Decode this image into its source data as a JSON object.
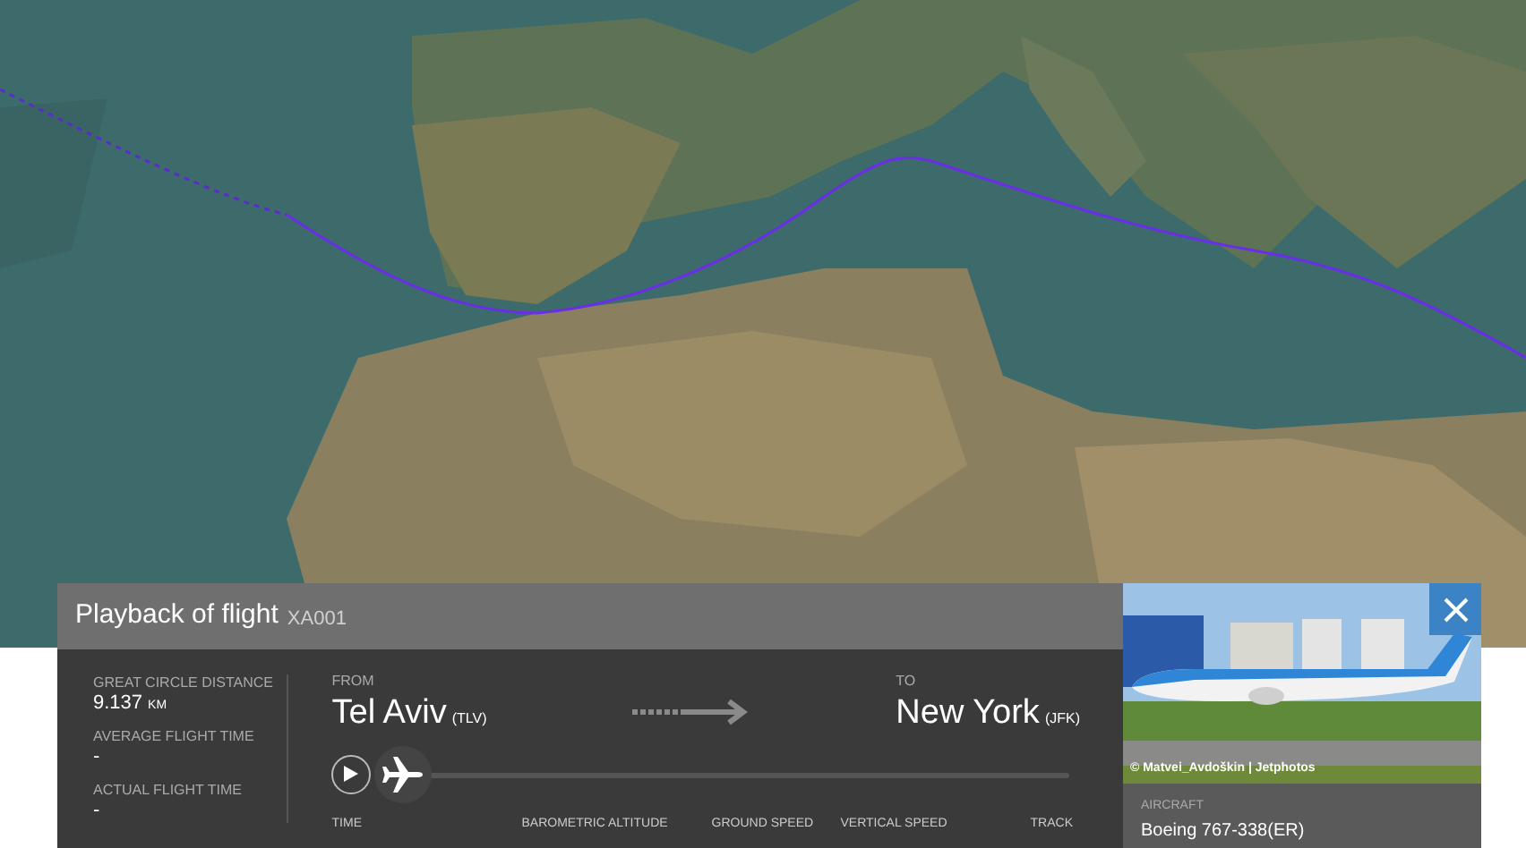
{
  "playback": {
    "title": "Playback of flight",
    "flight": "XA001",
    "stats": [
      {
        "label": "GREAT CIRCLE DISTANCE",
        "value": "9.137",
        "unit": "KM"
      },
      {
        "label": "AVERAGE FLIGHT TIME",
        "value": "-"
      },
      {
        "label": "ACTUAL FLIGHT TIME",
        "value": "-"
      }
    ],
    "from": {
      "label": "FROM",
      "city": "Tel Aviv",
      "code": "(TLV)"
    },
    "to": {
      "label": "TO",
      "city": "New York",
      "code": "(JFK)"
    },
    "progress": {
      "level": 0
    },
    "columns": [
      "TIME",
      "BAROMETRIC ALTITUDE",
      "GROUND SPEED",
      "VERTICAL SPEED",
      "TRACK"
    ]
  },
  "aircraft": {
    "credit": "© Matvei_Avdoškin | Jetphotos",
    "label": "AIRCRAFT",
    "model": "Boeing 767-338(ER)"
  }
}
